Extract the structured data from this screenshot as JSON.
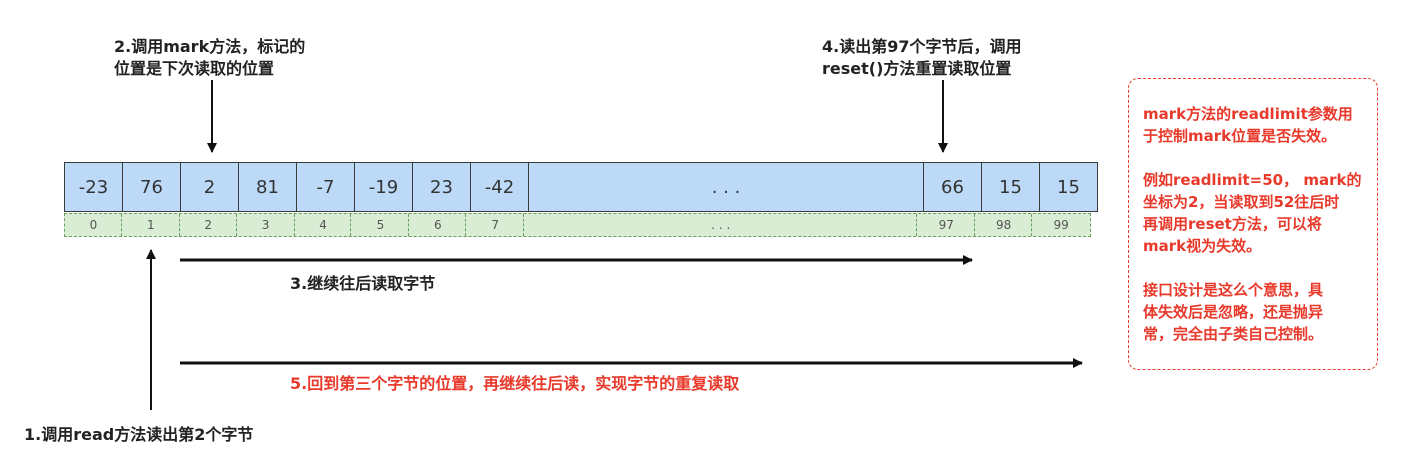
{
  "cells": [
    "-23",
    "76",
    "2",
    "81",
    "-7",
    "-19",
    "23",
    "-42",
    ". . .",
    "66",
    "15",
    "15"
  ],
  "indices": [
    "0",
    "1",
    "2",
    "3",
    "4",
    "5",
    "6",
    "7",
    ". . .",
    "97",
    "98",
    "99"
  ],
  "notes": {
    "step1": "1.调用read方法读出第2个字节",
    "step2": "2.调用mark方法，标记的\n位置是下次读取的位置",
    "step3": "3.继续往后读取字节",
    "step4": "4.读出第97个字节后，调用\nreset()方法重置读取位置",
    "step5": "5.回到第三个字节的位置，再继续往后读，实现字节的重复读取"
  },
  "side_box": {
    "para1": "mark方法的readlimit参数用\n于控制mark位置是否失效。",
    "para2": "例如readlimit=50， mark的\n坐标为2，当读取到52往后时\n再调用reset方法，可以将\nmark视为失效。",
    "para3": "接口设计是这么个意思，具\n体失效后是忽略，还是抛异\n常，完全由子类自己控制。"
  },
  "colors": {
    "cell_fill": "#bcdaf7",
    "index_fill": "#d8edd3",
    "index_border": "#6a9e63",
    "highlight": "#e8392b",
    "text": "#222222"
  }
}
